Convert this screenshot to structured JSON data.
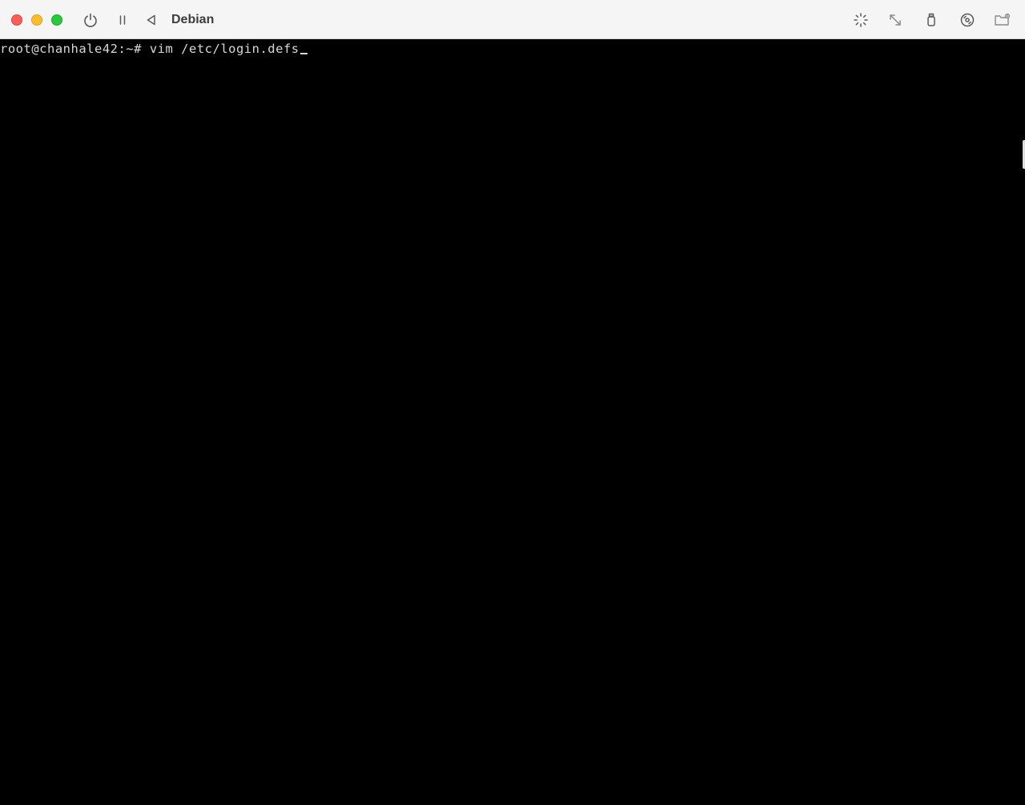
{
  "window": {
    "title": "Debian"
  },
  "toolbar": {
    "left_icons": [
      "power-icon",
      "pause-icon",
      "back-icon"
    ],
    "right_icons": [
      "capture-pointer-icon",
      "resize-icon",
      "usb-icon",
      "cd-dvd-icon",
      "shared-folder-icon"
    ]
  },
  "console": {
    "prompt": "root@chanhale42:~#",
    "command": "vim /etc/login.defs",
    "foreground": "#d8d8d8",
    "background": "#000000"
  },
  "colors": {
    "titlebar": "#f6f5f6",
    "close": "#fe5f57",
    "minimize": "#febc2e",
    "maximize": "#28c840"
  }
}
